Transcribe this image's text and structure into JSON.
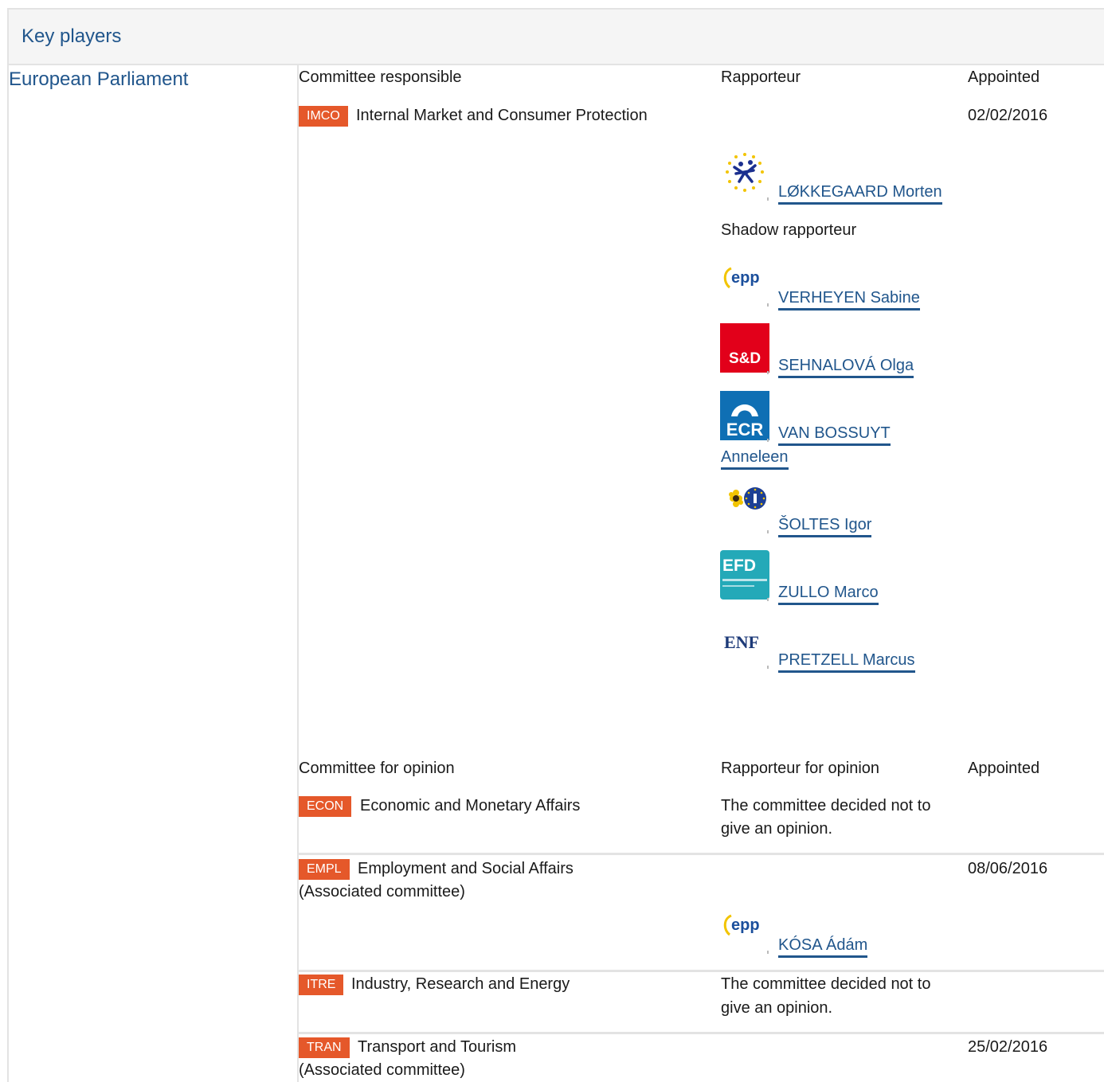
{
  "header": {
    "title": "Key players"
  },
  "left": {
    "title": "European Parliament"
  },
  "responsible": {
    "col_committee": "Committee responsible",
    "col_rapporteur": "Rapporteur",
    "col_appointed": "Appointed",
    "committee_code": "IMCO",
    "committee_name": "Internal Market and Consumer Protection",
    "appointed": "02/02/2016",
    "rapporteur": {
      "name": "LØKKEGAARD Morten",
      "group_icon": "alde-icon"
    },
    "shadow_label": "Shadow rapporteur",
    "shadows": [
      {
        "name": "VERHEYEN Sabine",
        "logo_text": "epp",
        "group_icon": "epp-icon"
      },
      {
        "name": "SEHNALOVÁ Olga",
        "logo_text": "S&D",
        "group_icon": "sd-icon"
      },
      {
        "name_line1": "VAN BOSSUYT",
        "name_line2": "Anneleen",
        "logo_text": "ECR",
        "group_icon": "ecr-icon"
      },
      {
        "name": "ŠOLTES Igor",
        "group_icon": "greens-efa-icon"
      },
      {
        "name": "ZULLO Marco",
        "logo_text": "EFD",
        "group_icon": "efdd-icon"
      },
      {
        "name": "PRETZELL Marcus",
        "logo_text": "ENF",
        "group_icon": "enf-icon"
      }
    ]
  },
  "opinion": {
    "col_committee": "Committee for opinion",
    "col_rapporteur": "Rapporteur for opinion",
    "col_appointed": "Appointed",
    "rows": [
      {
        "code": "ECON",
        "name": "Economic and Monetary Affairs",
        "note_line1": "The committee decided not to",
        "note_line2": "give an opinion."
      },
      {
        "code": "EMPL",
        "name": "Employment and Social Affairs",
        "assoc": "(Associated committee)",
        "appointed": "08/06/2016",
        "rapporteur": "KÓSA Ádám",
        "logo_text": "epp",
        "group_icon": "epp-icon"
      },
      {
        "code": "ITRE",
        "name": "Industry, Research and Energy",
        "note_line1": "The committee decided not to",
        "note_line2": "give an opinion."
      },
      {
        "code": "TRAN",
        "name": "Transport and Tourism",
        "assoc": "(Associated committee)",
        "appointed": "25/02/2016"
      }
    ]
  },
  "colors": {
    "link": "#21568c",
    "badge": "#e5582a",
    "border": "#e3e3e3",
    "header_bg": "#f5f5f5"
  }
}
